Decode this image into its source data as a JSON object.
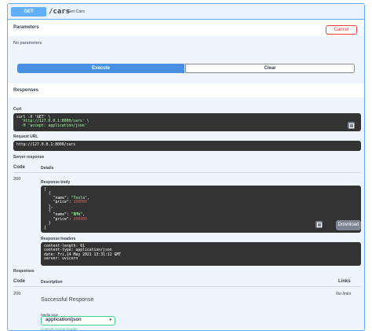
{
  "operation": {
    "method": "GET",
    "path": "/cars",
    "summary": "Get Cars"
  },
  "parameters": {
    "title": "Parameters",
    "cancel_label": "Cancel",
    "empty_text": "No parameters"
  },
  "actions": {
    "execute_label": "Execute",
    "clear_label": "Clear"
  },
  "responses_title": "Responses",
  "curl": {
    "label": "Curl",
    "lines": [
      "curl -X 'GET' \\",
      "  'http://127.0.0.1:8000/cars' \\",
      "  -H 'accept: application/json'"
    ]
  },
  "request_url": {
    "label": "Request URL",
    "value": "http://127.0.0.1:8000/cars"
  },
  "server_response": {
    "label": "Server response",
    "code_header": "Code",
    "details_header": "Details",
    "code": "200",
    "body_label": "Response body",
    "body": [
      {
        "name": "Tesla",
        "price": "100000"
      },
      {
        "name": "BMW",
        "price": "200000"
      }
    ],
    "download_label": "Download",
    "headers_label": "Response headers",
    "headers": [
      "content-length: 61",
      "content-type: application/json",
      "date: Fri,14 May 2021 13:31:12 GMT",
      "server: uvicorn"
    ]
  },
  "documented_responses": {
    "title": "Responses",
    "code_header": "Code",
    "description_header": "Description",
    "links_header": "Links",
    "code": "200",
    "description": "Successful Response",
    "links": "No links",
    "media_type_label": "Media type",
    "media_type_value": "application/json",
    "controls_text": "Controls Accept header."
  },
  "colors": {
    "get_blue": "#61affe",
    "execute_blue": "#4990e2",
    "cancel_red": "#f93e3e",
    "code_bg": "#333333",
    "select_green": "#49cc90"
  },
  "icons": [
    "copy-icon",
    "chevron-down-icon"
  ]
}
